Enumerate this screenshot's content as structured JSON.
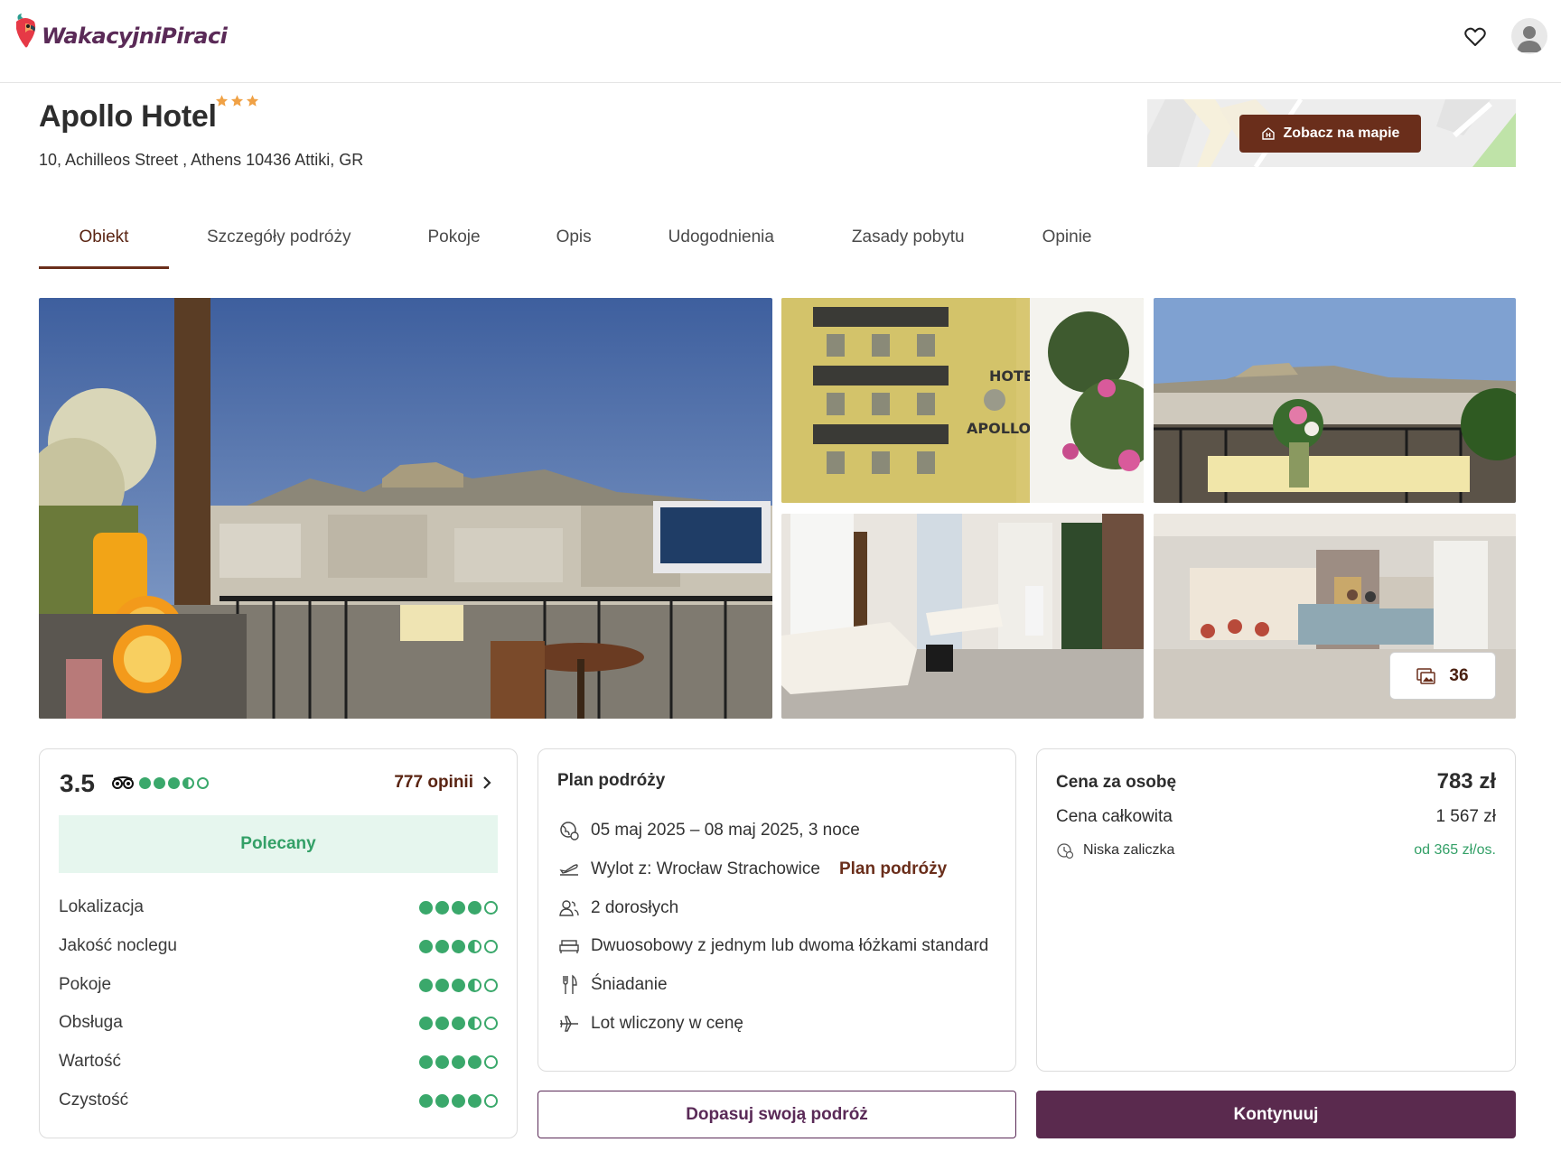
{
  "brand": {
    "logo_text": "WakacyjniPiraci"
  },
  "header": {
    "favorites_icon": "heart-icon",
    "account_icon": "user-icon"
  },
  "hotel": {
    "name": "Apollo Hotel",
    "stars": 3,
    "address": "10, Achilleos Street , Athens 10436 Attiki, GR",
    "map_button_label": "Zobacz na mapie"
  },
  "tabs": [
    {
      "label": "Obiekt",
      "active": true
    },
    {
      "label": "Szczegóły podróży",
      "active": false
    },
    {
      "label": "Pokoje",
      "active": false
    },
    {
      "label": "Opis",
      "active": false
    },
    {
      "label": "Udogodnienia",
      "active": false
    },
    {
      "label": "Zasady pobytu",
      "active": false
    },
    {
      "label": "Opinie",
      "active": false
    }
  ],
  "gallery": {
    "photo_count": "36"
  },
  "rating": {
    "score": "3.5",
    "tripadvisor_level": 3.5,
    "reviews_label": "777 opinii",
    "badge": "Polecany",
    "categories": [
      {
        "label": "Lokalizacja",
        "level": 4
      },
      {
        "label": "Jakość noclegu",
        "level": 3.5
      },
      {
        "label": "Pokoje",
        "level": 3.5
      },
      {
        "label": "Obsługa",
        "level": 3.5
      },
      {
        "label": "Wartość",
        "level": 4
      },
      {
        "label": "Czystość",
        "level": 4
      }
    ]
  },
  "plan": {
    "title": "Plan podróży",
    "dates": "05 maj 2025 – 08 maj 2025, 3 noce",
    "departure": "Wylot z: Wrocław Strachowice",
    "departure_link": "Plan podróży",
    "guests": "2 dorosłych",
    "room": "Dwuosobowy z jednym lub dwoma łóżkami standard",
    "board": "Śniadanie",
    "flight": "Lot wliczony w cenę"
  },
  "price": {
    "per_person_label": "Cena za osobę",
    "per_person_value": "783 zł",
    "total_label": "Cena całkowita",
    "total_value": "1 567 zł",
    "deposit_label": "Niska zaliczka",
    "deposit_value": "od 365 zł/os."
  },
  "actions": {
    "customize_label": "Dopasuj swoją podróż",
    "continue_label": "Kontynuuj"
  }
}
